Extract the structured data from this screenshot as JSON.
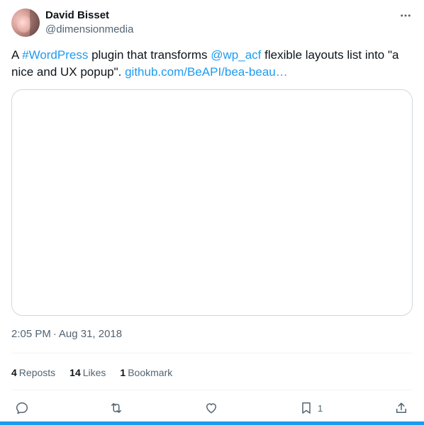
{
  "author": {
    "display_name": "David Bisset",
    "handle": "@dimensionmedia"
  },
  "tweet": {
    "text_prefix": "A ",
    "hashtag": "#WordPress",
    "text_mid": " plugin that transforms ",
    "mention": "@wp_acf",
    "text_suffix": " flexible layouts list into \"a nice and UX popup\". ",
    "link": "github.com/BeAPI/bea-beau…"
  },
  "timestamp": {
    "time": "2:05 PM",
    "separator": "·",
    "date": "Aug 31, 2018"
  },
  "stats": {
    "reposts_count": "4",
    "reposts_label": "Reposts",
    "likes_count": "14",
    "likes_label": "Likes",
    "bookmarks_count": "1",
    "bookmarks_label": "Bookmark"
  },
  "actions": {
    "bookmark_count": "1"
  },
  "colors": {
    "accent": "#1d9bf0",
    "text": "#0f1419",
    "secondary": "#536471",
    "border": "#cfd9de"
  },
  "icons": [
    "more-icon",
    "reply-icon",
    "repost-icon",
    "like-icon",
    "bookmark-icon",
    "share-icon"
  ]
}
